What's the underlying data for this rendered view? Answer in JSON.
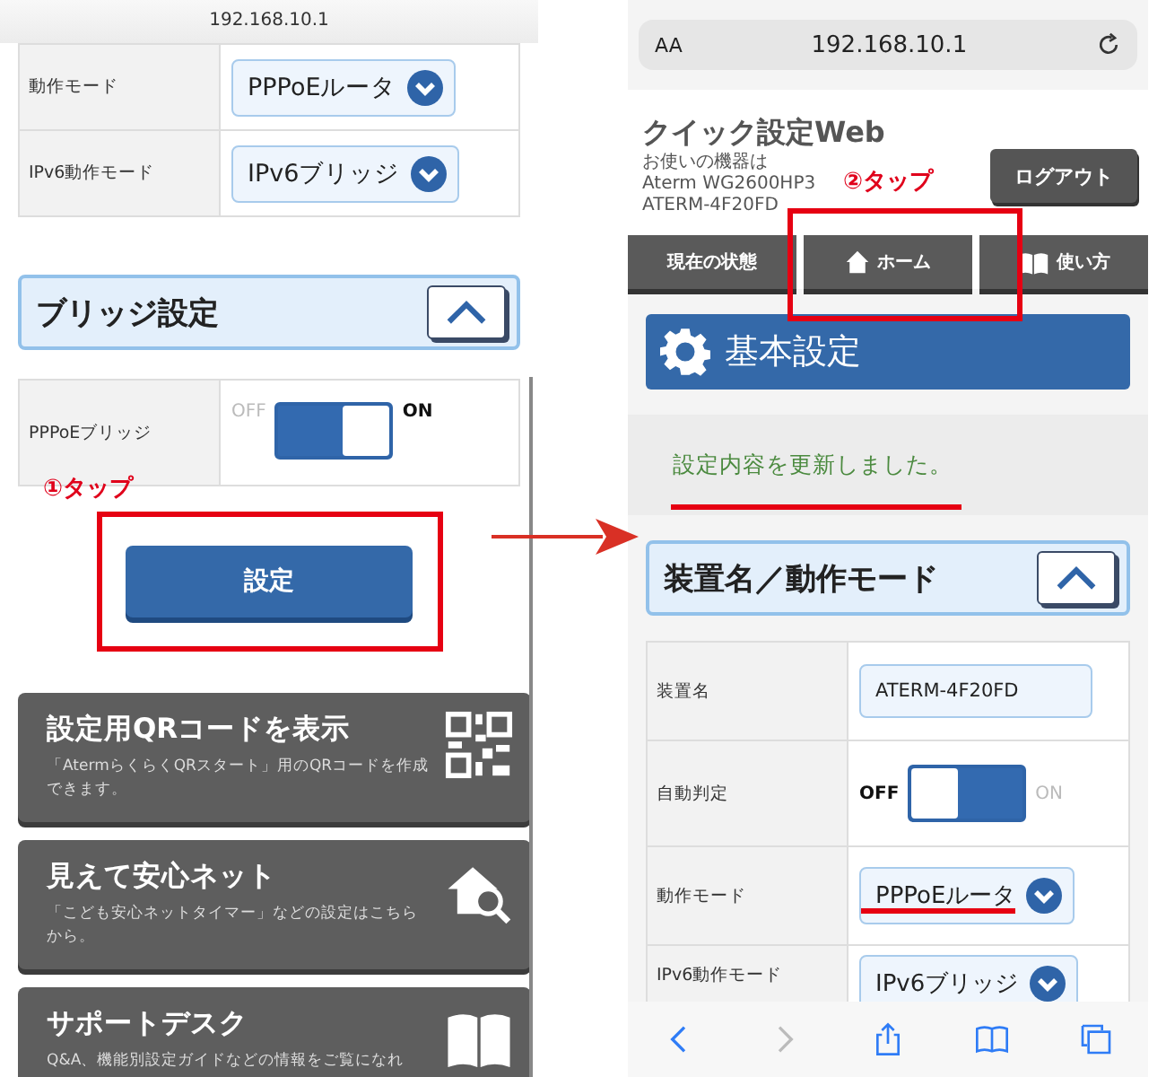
{
  "left_screen": {
    "address": "192.168.10.1",
    "mode_rows": [
      {
        "label": "動作モード",
        "kind": "select",
        "value": "PPPoEルータ"
      },
      {
        "label": "IPv6動作モード",
        "kind": "select",
        "value": "IPv6ブリッジ"
      }
    ],
    "section": {
      "title": "ブリッジ設定",
      "expanded": true
    },
    "bridge_rows": [
      {
        "label": "PPPoEブリッジ",
        "kind": "toggle",
        "off_label": "OFF",
        "on_label": "ON",
        "on": true
      }
    ],
    "annotation": "①タップ",
    "submit_button": "設定",
    "menu_cards": [
      {
        "kind": "qr",
        "title": "設定用QRコードを表示",
        "description": "「AtermらくらくQRスタート」用のQRコードを作成できます。"
      },
      {
        "kind": "home-search",
        "title": "見えて安心ネット",
        "description": "「こども安心ネットタイマー」などの設定はこちらから。"
      },
      {
        "kind": "book",
        "title": "サポートデスク",
        "description": "Q&A、機能別設定ガイドなどの情報をご覧になれ"
      }
    ]
  },
  "right_screen": {
    "text_size_button": "AA",
    "address": "192.168.10.1",
    "app_title": "クイック設定Web",
    "device_info": [
      "お使いの機器は",
      "Aterm WG2600HP3",
      "ATERM-4F20FD"
    ],
    "annotation": "②タップ",
    "logout_button": "ログアウト",
    "nav_tabs": [
      {
        "kind": "plain",
        "label": "現在の状態"
      },
      {
        "kind": "home",
        "label": "ホーム"
      },
      {
        "kind": "book",
        "label": "使い方"
      }
    ],
    "banner": "基本設定",
    "message": "設定内容を更新しました。",
    "section": {
      "title": "装置名／動作モード",
      "expanded": true
    },
    "rows": [
      {
        "label": "装置名",
        "kind": "input",
        "value": "ATERM-4F20FD"
      },
      {
        "label": "自動判定",
        "kind": "toggle",
        "off_label": "OFF",
        "on_label": "ON",
        "on": false
      },
      {
        "label": "動作モード",
        "kind": "select",
        "value": "PPPoEルータ"
      },
      {
        "label": "IPv6動作モード",
        "kind": "select",
        "value": "IPv6ブリッジ"
      }
    ],
    "toolbar": [
      {
        "kind": "back",
        "disabled": false
      },
      {
        "kind": "forward",
        "disabled": true
      },
      {
        "kind": "share",
        "disabled": false
      },
      {
        "kind": "bookmarks",
        "disabled": false
      },
      {
        "kind": "tabs",
        "disabled": false
      }
    ]
  }
}
